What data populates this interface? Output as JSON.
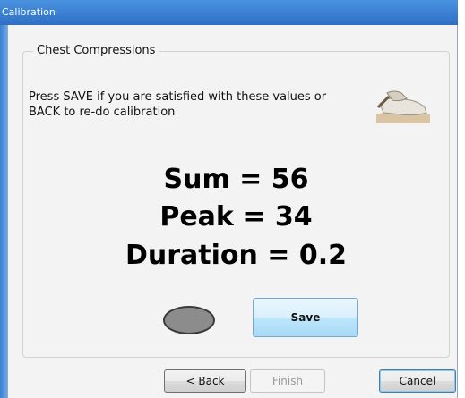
{
  "window": {
    "title": "Calibration"
  },
  "group": {
    "title": "Chest Compressions"
  },
  "instructions": {
    "line1": "Press SAVE if you are satisfied with these values or",
    "line2": "BACK to re-do calibration"
  },
  "metrics": {
    "sum": "Sum = 56",
    "peak": "Peak = 34",
    "duration": "Duration = 0.2"
  },
  "indicator": {
    "icon": "status-led-icon",
    "color": "#8c8c8c"
  },
  "buttons": {
    "save": "Save",
    "back": "< Back",
    "finish": "Finish",
    "cancel": "Cancel"
  }
}
